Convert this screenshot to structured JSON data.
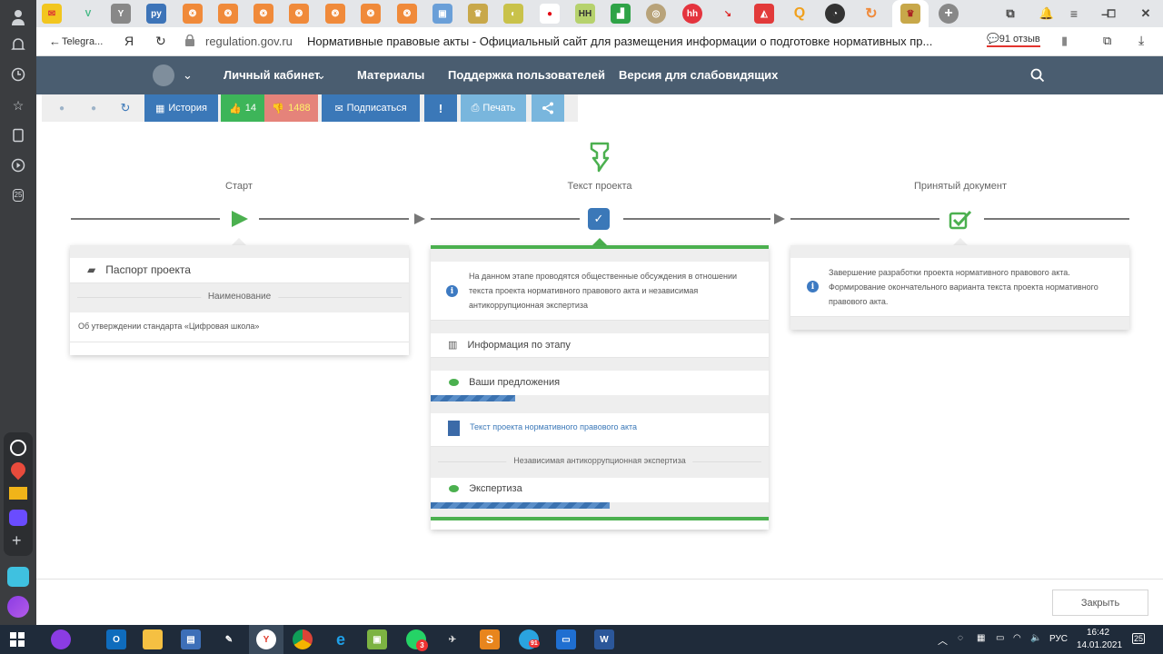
{
  "browser": {
    "back_label": "Telegra...",
    "yandex_label": "Я",
    "domain": "regulation.gov.ru",
    "page_title": "Нормативные правовые акты - Официальный сайт для размещения информации о подготовке нормативных пр...",
    "reviews_label": "91 отзыв",
    "side_badge": "25"
  },
  "site_nav": {
    "items": [
      "Личный кабинет",
      "Материалы",
      "Поддержка пользователей",
      "Версия для слабовидящих"
    ]
  },
  "toolbar": {
    "history_label": "История",
    "likes_count": "14",
    "dislikes_count": "1488",
    "subscribe_label": "Подписаться",
    "print_label": "Печать"
  },
  "timeline": {
    "stages": [
      "Старт",
      "Текст проекта",
      "Принятый документ"
    ]
  },
  "cards": {
    "start": {
      "passport_label": "Паспорт проекта",
      "name_header": "Наименование",
      "name_value": "Об утверждении стандарта «Цифровая школа»"
    },
    "text": {
      "info": "На данном этапе проводятся общественные обсуждения в отношении текста проекта нормативного правового акта и независимая антикоррупционная экспертиза",
      "stage_info_label": "Информация по этапу",
      "proposals_label": "Ваши предложения",
      "proposals_progress": 0.25,
      "document_link": "Текст проекта нормативного правового акта",
      "expertise_header": "Независимая антикоррупционная экспертиза",
      "expertise_label": "Экспертиза",
      "expertise_progress": 0.53
    },
    "accepted": {
      "info": "Завершение разработки проекта нормативного правового акта. Формирование окончательного варианта текста проекта нормативного правового акта."
    }
  },
  "close_label": "Закрыть",
  "taskbar": {
    "lang": "РУС",
    "time": "16:42",
    "date": "14.01.2021",
    "notif_count": "25",
    "mail_badge": "3",
    "tg_badge": "91"
  },
  "colors": {
    "accent_blue": "#3d7ac2",
    "green": "#4bb04f",
    "nav_bg": "#4a5d70",
    "btn_blue": "#3b78b8",
    "btn_green": "#3db559",
    "btn_red": "#e5837a"
  }
}
